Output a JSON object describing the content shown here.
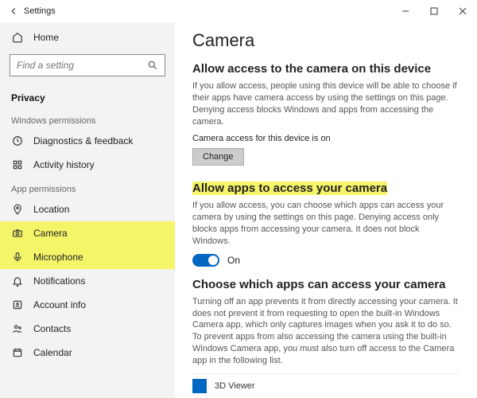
{
  "window": {
    "title": "Settings"
  },
  "sidebar": {
    "home": "Home",
    "search_placeholder": "Find a setting",
    "current": "Privacy",
    "group1": "Windows permissions",
    "items1": [
      {
        "label": "Diagnostics & feedback"
      },
      {
        "label": "Activity history"
      }
    ],
    "group2": "App permissions",
    "items2": [
      {
        "label": "Location"
      },
      {
        "label": "Camera"
      },
      {
        "label": "Microphone"
      },
      {
        "label": "Notifications"
      },
      {
        "label": "Account info"
      },
      {
        "label": "Contacts"
      },
      {
        "label": "Calendar"
      }
    ]
  },
  "main": {
    "title": "Camera",
    "s1_h": "Allow access to the camera on this device",
    "s1_p": "If you allow access, people using this device will be able to choose if their apps have camera access by using the settings on this page. Denying access blocks Windows and apps from accessing the camera.",
    "s1_status": "Camera access for this device is on",
    "s1_btn": "Change",
    "s2_h": "Allow apps to access your camera",
    "s2_p": "If you allow access, you can choose which apps can access your camera by using the settings on this page. Denying access only blocks apps from accessing your camera. It does not block Windows.",
    "toggle_label": "On",
    "s3_h": "Choose which apps can access your camera",
    "s3_p": "Turning off an app prevents it from directly accessing your camera. It does not prevent it from requesting to open the built-in Windows Camera app, which only captures images when you ask it to do so. To prevent apps from also accessing the camera using the built-in Windows Camera app, you must also turn off access to the Camera app in the following list.",
    "app1": "3D Viewer"
  }
}
